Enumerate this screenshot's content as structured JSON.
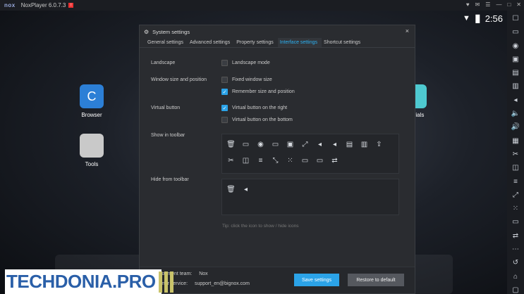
{
  "titlebar": {
    "logo": "nox",
    "version": "NoxPlayer 6.0.7.3",
    "badge": "!",
    "controls": [
      "♥",
      "✉",
      "☰",
      "—",
      "□",
      "✕"
    ]
  },
  "status": {
    "time": "2:56",
    "wifi": "▼",
    "battery": "▮"
  },
  "rightbar": {
    "icons": [
      "☐",
      "▭",
      "◉",
      "▣",
      "▤",
      "▥",
      "◂",
      "🔈",
      "🔊",
      "▦",
      "✂",
      "◫",
      "≡",
      "⤢",
      "⁙",
      "▭",
      "⇄",
      "⋯",
      "↺",
      "⌂",
      "▢"
    ]
  },
  "desktop": {
    "apps": [
      {
        "label": "Browser"
      },
      {
        "label": "Tools"
      },
      {
        "label": "rials"
      }
    ]
  },
  "dialog": {
    "title": "System settings",
    "close": "×",
    "tabs": [
      {
        "label": "General settings",
        "active": false
      },
      {
        "label": "Advanced settings",
        "active": false
      },
      {
        "label": "Property settings",
        "active": false
      },
      {
        "label": "Interface settings",
        "active": true
      },
      {
        "label": "Shortcut settings",
        "active": false
      }
    ],
    "sections": {
      "landscape": {
        "label": "Landscape",
        "options": [
          {
            "text": "Landscape mode",
            "checked": false
          }
        ]
      },
      "window": {
        "label": "Window size and position",
        "options": [
          {
            "text": "Fixed window size",
            "checked": false
          },
          {
            "text": "Remember size and position",
            "checked": true
          }
        ]
      },
      "virtual": {
        "label": "Virtual button",
        "options": [
          {
            "text": "Virtual button on the right",
            "checked": true
          },
          {
            "text": "Virtual button on the bottom",
            "checked": false
          }
        ]
      },
      "show": {
        "label": "Show in toolbar"
      },
      "hide": {
        "label": "Hide from toolbar"
      }
    },
    "toolbar_show_icons": [
      "🗑",
      "▭",
      "◉",
      "▭",
      "▣",
      "⤢",
      "◂",
      "◂",
      "▤",
      "▥",
      "⇪",
      "✂",
      "◫",
      "≡",
      "⤡",
      "⁙",
      "▭",
      "▭",
      "⇄"
    ],
    "toolbar_hide_icons": [
      "🗑",
      "◂"
    ],
    "tip": "Tip: click the icon to show / hide icons",
    "footer": {
      "dev_label": "elopment team:",
      "dev_value": "Nox",
      "svc_label": "omer service:",
      "svc_value": "support_en@bignox.com",
      "save": "Save settings",
      "restore": "Restore to default"
    }
  },
  "watermark": {
    "text": "TECHDONIA.PRO"
  },
  "colors": {
    "accent": "#2ba3e8",
    "dialog_bg": "#2a2c30",
    "brand_blue": "#2a5fa8"
  }
}
